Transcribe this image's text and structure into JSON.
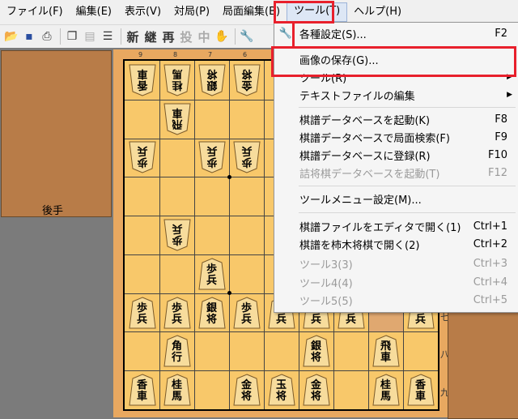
{
  "menubar": {
    "items": [
      "ファイル(F)",
      "編集(E)",
      "表示(V)",
      "対局(P)",
      "局面編集(B)",
      "ツール(T)",
      "ヘルプ(H)"
    ]
  },
  "toolbar": {
    "text_buttons": [
      "新",
      "継",
      "再",
      "投",
      "中"
    ]
  },
  "left_panel": {
    "label": "後手"
  },
  "board": {
    "column_numbers": [
      "9",
      "8",
      "7",
      "6"
    ],
    "row_labels": [
      "七",
      "八",
      "九"
    ]
  },
  "pieces": {
    "kyo": "香\n車",
    "kei": "桂\n馬",
    "gin": "銀\n将",
    "kin": "金\n将",
    "fu": "歩\n兵",
    "hi": "飛\n車",
    "kaku": "角\n行",
    "gyoku": "玉\n将"
  },
  "tools_menu": {
    "items": [
      {
        "label": "各種設定(S)...",
        "shortcut": "F2",
        "icon": "wrench-icon"
      },
      {
        "label": "画像の保存(G)...",
        "shortcut": ""
      },
      {
        "label": "ツール(R)",
        "shortcut": "",
        "submenu": true
      },
      {
        "label": "テキストファイルの編集",
        "shortcut": "",
        "submenu": true
      },
      {
        "label": "棋譜データベースを起動(K)",
        "shortcut": "F8"
      },
      {
        "label": "棋譜データベースで局面検索(F)",
        "shortcut": "F9"
      },
      {
        "label": "棋譜データベースに登録(R)",
        "shortcut": "F10"
      },
      {
        "label": "詰将棋データベースを起動(T)",
        "shortcut": "F12",
        "disabled": true
      },
      {
        "label": "ツールメニュー設定(M)...",
        "shortcut": ""
      },
      {
        "label": "棋譜ファイルをエディタで開く(1)",
        "shortcut": "Ctrl+1"
      },
      {
        "label": "棋譜を柿木将棋で開く(2)",
        "shortcut": "Ctrl+2"
      },
      {
        "label": "ツール3(3)",
        "shortcut": "Ctrl+3",
        "disabled": true
      },
      {
        "label": "ツール4(4)",
        "shortcut": "Ctrl+4",
        "disabled": true
      },
      {
        "label": "ツール5(5)",
        "shortcut": "Ctrl+5",
        "disabled": true
      }
    ]
  },
  "colors": {
    "highlight": "#e8202c",
    "board": "#f8c86a",
    "panel": "#b87c48"
  }
}
